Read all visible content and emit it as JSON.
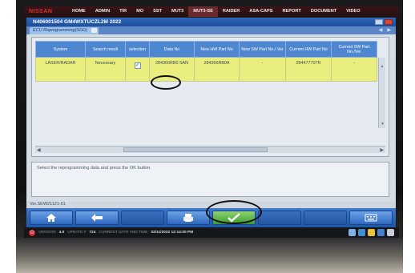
{
  "top_menu": {
    "logo": "NISSAN",
    "items": [
      "HOME",
      "ADMIN",
      "TIR",
      "MO",
      "SST",
      "MUT3",
      "MUT3-SE",
      "RAIDER",
      "ASA-CAPS",
      "REPORT",
      "DOCUMENT",
      "VIDEO"
    ],
    "active": "MUT3-SE"
  },
  "window": {
    "title": "N406001504  GM4WXTUCZL2M 2022",
    "tab_label": "ECU Reprogramming(SDD)"
  },
  "table": {
    "columns": [
      "System",
      "Search result",
      "selection",
      "Data No",
      "New HW Part No",
      "New SW Part No./ Ver",
      "Current HW Part No",
      "Current SW Part No./Ver"
    ],
    "rows": [
      {
        "system": "LASER/RADAR",
        "search_result": "Necessary",
        "selected": true,
        "data_no": "284366RB0 SAN",
        "new_hw": "284366RB0A",
        "new_sw": "-",
        "current_hw": "284477707R",
        "current_sw": "-"
      }
    ]
  },
  "message": "Select the reprogramming data and press the OK button.",
  "version": "Ver.SEW21121-01",
  "buttons": {
    "home": "home-icon",
    "back": "back-arrow-icon",
    "print": "printer-icon",
    "ok": "checkmark-icon",
    "keyboard": "keyboard-icon"
  },
  "status": {
    "version_label": "VERSION",
    "version_value": "4.0",
    "update_label": "UPDATE #",
    "update_value": "724",
    "datetime_label": "CURRENT DATE AND TIME",
    "datetime_value": "02/11/2022 12:14:00 PM"
  }
}
